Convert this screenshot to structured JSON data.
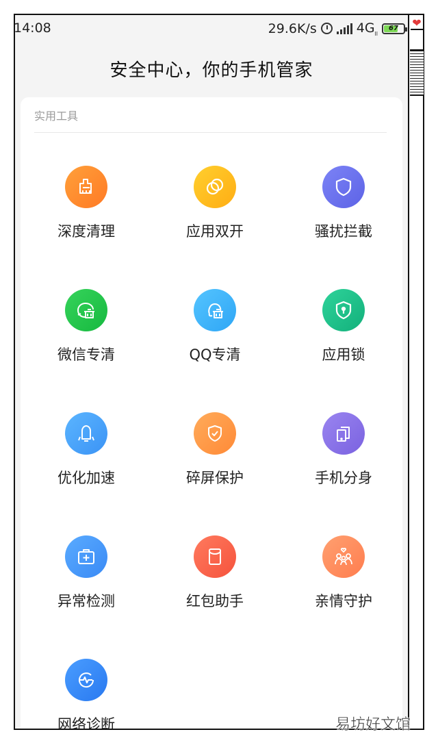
{
  "status_bar": {
    "time": "14:08",
    "speed": "29.6K/s",
    "network": "4G",
    "network_small": "ll",
    "battery": "67",
    "battery_fraction": 0.67
  },
  "header": {
    "title": "安全中心，你的手机管家"
  },
  "section": {
    "title": "实用工具"
  },
  "tools": [
    {
      "label": "深度清理",
      "icon": "clean-icon",
      "colors": [
        "#ffa03a",
        "#ff7a25"
      ]
    },
    {
      "label": "应用双开",
      "icon": "dual-apps-icon",
      "colors": [
        "#ffcf2e",
        "#ffad14"
      ]
    },
    {
      "label": "骚扰拦截",
      "icon": "shield-icon",
      "colors": [
        "#7c83f6",
        "#5d63e6"
      ]
    },
    {
      "label": "微信专清",
      "icon": "wechat-clean-icon",
      "colors": [
        "#36d35b",
        "#16b93f"
      ]
    },
    {
      "label": "QQ专清",
      "icon": "qq-clean-icon",
      "colors": [
        "#55c4ff",
        "#2ea6f5"
      ]
    },
    {
      "label": "应用锁",
      "icon": "app-lock-icon",
      "colors": [
        "#2ed39a",
        "#13b07b"
      ]
    },
    {
      "label": "优化加速",
      "icon": "boost-icon",
      "colors": [
        "#5bb5ff",
        "#3b93f5"
      ]
    },
    {
      "label": "碎屏保护",
      "icon": "screen-protect-icon",
      "colors": [
        "#ffab5a",
        "#ff8a37"
      ]
    },
    {
      "label": "手机分身",
      "icon": "second-space-icon",
      "colors": [
        "#9a85f0",
        "#7a62e0"
      ]
    },
    {
      "label": "异常检测",
      "icon": "anomaly-check-icon",
      "colors": [
        "#5aabff",
        "#3a8af5"
      ]
    },
    {
      "label": "红包助手",
      "icon": "red-packet-icon",
      "colors": [
        "#ff7a5e",
        "#f5533d"
      ]
    },
    {
      "label": "亲情守护",
      "icon": "family-guard-icon",
      "colors": [
        "#ffa070",
        "#ff7d4f"
      ]
    },
    {
      "label": "网络诊断",
      "icon": "network-diagnosis-icon",
      "colors": [
        "#4a9dff",
        "#2979f0"
      ]
    }
  ],
  "watermark": "易坊好文馆"
}
